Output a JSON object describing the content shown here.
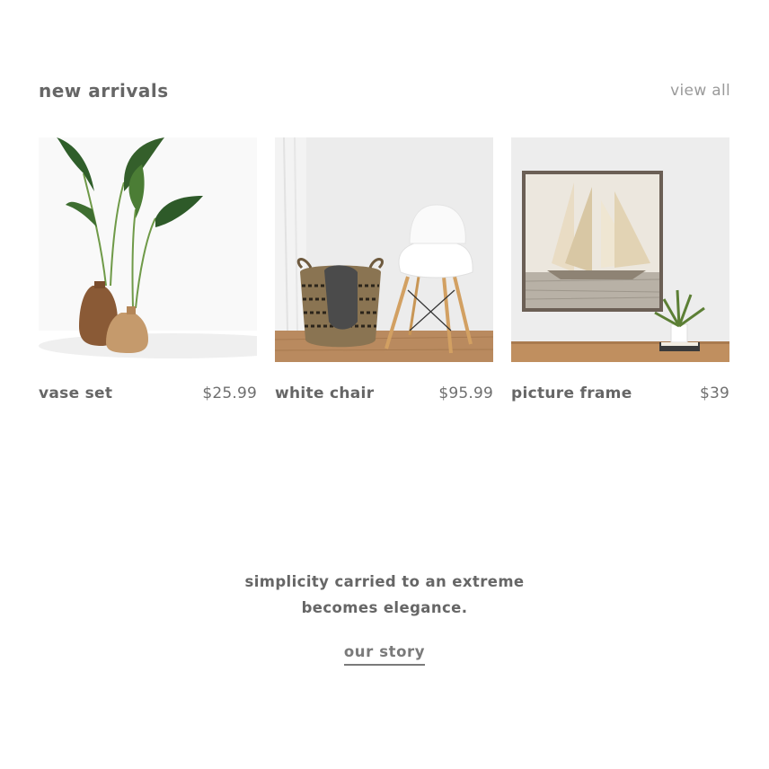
{
  "section": {
    "title": "new arrivals",
    "view_all_label": "view all"
  },
  "products": [
    {
      "name": "vase set",
      "price": "$25.99",
      "image": "vase-set-photo"
    },
    {
      "name": "white chair",
      "price": "$95.99",
      "image": "white-chair-photo"
    },
    {
      "name": "picture frame",
      "price": "$39",
      "image": "picture-frame-photo"
    }
  ],
  "quote": {
    "line1": "simplicity carried to an extreme",
    "line2": "becomes elegance."
  },
  "cta": {
    "label": "our story"
  },
  "colors": {
    "text": "#666666",
    "muted": "#9a9a9a",
    "background": "#ffffff"
  }
}
